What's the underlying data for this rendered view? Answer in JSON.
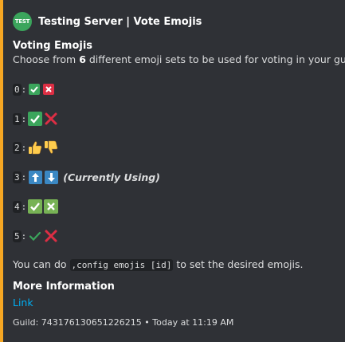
{
  "author": {
    "avatar_text": "TEST",
    "name": "Testing Server | Vote Emojis"
  },
  "title": "Voting Emojis",
  "description": {
    "prefix": "Choose from ",
    "count": "6",
    "suffix": " different emoji sets to be used for voting in your guild."
  },
  "sets": [
    {
      "id": "0",
      "emojis": [
        "check-box-small-icon",
        "cross-box-small-icon"
      ],
      "note": ""
    },
    {
      "id": "1",
      "emojis": [
        "heavy-check-icon",
        "red-cross-icon"
      ],
      "note": ""
    },
    {
      "id": "2",
      "emojis": [
        "thumbs-up-icon",
        "thumbs-down-icon"
      ],
      "note": ""
    },
    {
      "id": "3",
      "emojis": [
        "arrow-up-box-icon",
        "arrow-down-box-icon"
      ],
      "note": "(Currently Using)"
    },
    {
      "id": "4",
      "emojis": [
        "check-box-green-icon",
        "cross-box-green-icon"
      ],
      "note": ""
    },
    {
      "id": "5",
      "emojis": [
        "thin-check-icon",
        "red-cross-icon"
      ],
      "note": ""
    }
  ],
  "instruction": {
    "prefix": "You can do ",
    "command": ",config emojis [id]",
    "suffix": " to set the desired emojis."
  },
  "field": {
    "name": "More Information",
    "link": "Link"
  },
  "footer": {
    "guild": "Guild: 743176130651226215",
    "separator": "•",
    "time": "Today at 11:19 AM"
  },
  "colors": {
    "accent": "#f5a623",
    "embed_bg": "#2f3136",
    "link": "#00aff4",
    "green": "#3ba55c",
    "red": "#dd2e44",
    "blue": "#3b88c3"
  }
}
